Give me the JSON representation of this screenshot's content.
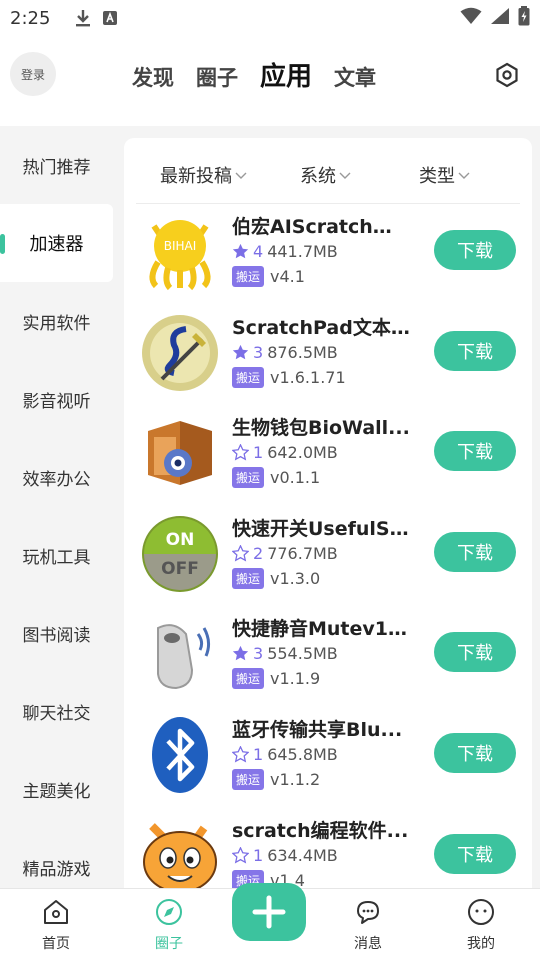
{
  "status_bar": {
    "time": "2:25"
  },
  "header": {
    "login_label": "登录",
    "tabs": [
      {
        "label": "发现"
      },
      {
        "label": "圈子"
      },
      {
        "label": "应用"
      },
      {
        "label": "文章"
      }
    ],
    "settings_icon": "settings-hexagon-icon"
  },
  "sidebar": {
    "items": [
      {
        "label": "热门推荐"
      },
      {
        "label": "加速器"
      },
      {
        "label": "实用软件"
      },
      {
        "label": "影音视听"
      },
      {
        "label": "效率办公"
      },
      {
        "label": "玩机工具"
      },
      {
        "label": "图书阅读"
      },
      {
        "label": "聊天社交"
      },
      {
        "label": "主题美化"
      },
      {
        "label": "精品游戏"
      }
    ]
  },
  "filters": {
    "sort": "最新投稿",
    "system": "系统",
    "type": "类型"
  },
  "apps": [
    {
      "name": "伯宏AIScratch图...",
      "rating": "4",
      "star_filled": true,
      "size": "441.7MB",
      "tag": "搬运",
      "version": "v4.1",
      "button": "下载",
      "icon": "octocat-bihai-icon"
    },
    {
      "name": "ScratchPad文本...",
      "rating": "3",
      "star_filled": true,
      "size": "876.5MB",
      "tag": "搬运",
      "version": "v1.6.1.71",
      "button": "下载",
      "icon": "scratchpad-icon"
    },
    {
      "name": "生物钱包BioWall...",
      "rating": "1",
      "star_filled": false,
      "size": "642.0MB",
      "tag": "搬运",
      "version": "v0.1.1",
      "button": "下载",
      "icon": "wallet-icon"
    },
    {
      "name": "快速开关UsefulS...",
      "rating": "2",
      "star_filled": false,
      "size": "776.7MB",
      "tag": "搬运",
      "version": "v1.3.0",
      "button": "下载",
      "icon": "on-off-switch-icon"
    },
    {
      "name": "快捷静音Mutev1....",
      "rating": "3",
      "star_filled": true,
      "size": "554.5MB",
      "tag": "搬运",
      "version": "v1.1.9",
      "button": "下载",
      "icon": "whistle-icon"
    },
    {
      "name": "蓝牙传输共享Blu...",
      "rating": "1",
      "star_filled": false,
      "size": "645.8MB",
      "tag": "搬运",
      "version": "v1.1.2",
      "button": "下载",
      "icon": "bluetooth-icon"
    },
    {
      "name": "scratch编程软件...",
      "rating": "1",
      "star_filled": false,
      "size": "634.4MB",
      "tag": "搬运",
      "version": "v1.4",
      "button": "下载",
      "icon": "scratch-cat-icon"
    }
  ],
  "bottom_nav": {
    "items": [
      {
        "label": "首页",
        "icon": "home-icon"
      },
      {
        "label": "圈子",
        "icon": "compass-icon"
      },
      {
        "label": "消息",
        "icon": "chat-bubbles-icon"
      },
      {
        "label": "我的",
        "icon": "profile-face-icon"
      }
    ],
    "plus_icon": "plus-icon"
  },
  "colors": {
    "accent": "#3cc39e",
    "tag": "#8575e8",
    "star": "#7b6ee6"
  }
}
